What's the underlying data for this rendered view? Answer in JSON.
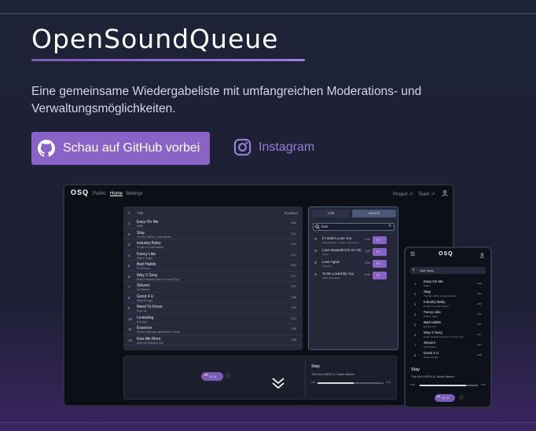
{
  "header": {
    "title": "OpenSoundQueue",
    "tagline": "Eine gemeinsame Wiedergabeliste mit umfangreichen Moderations- und Verwaltungsmöglichkeiten."
  },
  "actions": {
    "github_label": "Schau auf GitHub vorbei",
    "instagram_label": "Instagram"
  },
  "colors": {
    "accent": "#8a63c7",
    "link": "#9b7fd6",
    "background": "#1e2236"
  },
  "laptop": {
    "logo": "OSQ",
    "nav": {
      "public": "Public",
      "home": "Home",
      "settings": "Settings",
      "project": "Project ↗",
      "team": "Team ↗"
    },
    "table": {
      "col_num": "#",
      "col_title": "Title",
      "col_duration": "Duration",
      "rows": [
        {
          "n": "1",
          "title": "Easy On Me",
          "artist": "Adele",
          "dur": "3:45"
        },
        {
          "n": "2",
          "title": "Stay",
          "artist": "The Kid LAROI & Justin Bieber",
          "dur": "2:21"
        },
        {
          "n": "3",
          "title": "Industry Baby",
          "artist": "Lil Nas X & Jack Harlow",
          "dur": "3:32"
        },
        {
          "n": "4",
          "title": "Fancy Like",
          "artist": "Walker Hayes",
          "dur": "2:41"
        },
        {
          "n": "5",
          "title": "Bad Habits",
          "artist": "Ed Sheeran",
          "dur": "3:51"
        },
        {
          "n": "6",
          "title": "Way 2 Sexy",
          "artist": "Drake Featuring Future & Young Thug",
          "dur": "4:17"
        },
        {
          "n": "7",
          "title": "Shivers",
          "artist": "Ed Sheeran",
          "dur": "3:27"
        },
        {
          "n": "8",
          "title": "Good 4 U",
          "artist": "Olivia Rodrigo",
          "dur": "2:58"
        },
        {
          "n": "9",
          "title": "Need To Know",
          "artist": "Doja Cat",
          "dur": "3:30"
        },
        {
          "n": "10",
          "title": "Levitating",
          "artist": "Dua Lipa",
          "dur": "3:23"
        },
        {
          "n": "11",
          "title": "Essence",
          "artist": "WizKid Featuring Justin Bieber & Tems",
          "dur": "4:08"
        },
        {
          "n": "12",
          "title": "Kiss Me More",
          "artist": "Doja Cat Featuring SZA",
          "dur": "3:28"
        }
      ]
    },
    "search": {
      "tab_link": "Link",
      "tab_search": "Search",
      "query": "love",
      "results": [
        {
          "title": "If I Didn't Love You",
          "artist": "Jason Aldean & Carrie Underwood",
          "dur": "3:42"
        },
        {
          "title": "Love Nwantiti (Ah Ah Ah)",
          "artist": "CKay",
          "dur": "2:25"
        },
        {
          "title": "Love Again",
          "artist": "Dua Lipa",
          "dur": "4:18"
        },
        {
          "title": "To Be Loved By You",
          "artist": "Parker McCollum",
          "dur": "3:30"
        }
      ]
    },
    "player": {
      "queue": "0 / 3",
      "song": "Stay",
      "artist": "The Kid LAROI & Justin Bieber",
      "time_current": "1:18",
      "time_total": "2:21",
      "progress": 0.55
    }
  },
  "phone": {
    "logo": "OSQ",
    "add_song": "Add Song",
    "rows": [
      {
        "n": "1",
        "title": "Easy On Me",
        "artist": "Adele",
        "dur": "3:45"
      },
      {
        "n": "2",
        "title": "Stay",
        "artist": "The Kid LAROI & Justin Bieber",
        "dur": "2:21"
      },
      {
        "n": "3",
        "title": "Industry Baby",
        "artist": "Lil Nas X & Jack Harlow",
        "dur": "3:32"
      },
      {
        "n": "4",
        "title": "Fancy Like",
        "artist": "Walker Hayes",
        "dur": "2:41"
      },
      {
        "n": "5",
        "title": "Bad Habits",
        "artist": "Ed Sheeran",
        "dur": "3:51"
      },
      {
        "n": "6",
        "title": "Way 2 Sexy",
        "artist": "Drake Featuring Future & Young Thug",
        "dur": "4:17"
      },
      {
        "n": "7",
        "title": "Shivers",
        "artist": "Ed Sheeran",
        "dur": "3:27"
      },
      {
        "n": "8",
        "title": "Good 4 U",
        "artist": "Olivia Rodrigo",
        "dur": "2:58"
      }
    ],
    "player": {
      "song": "Stay",
      "artist": "The Kid LAROI & Justin Bieber",
      "time_current": "1:56",
      "time_total": "2:21",
      "queue": "0 / 3",
      "progress": 0.8
    }
  }
}
